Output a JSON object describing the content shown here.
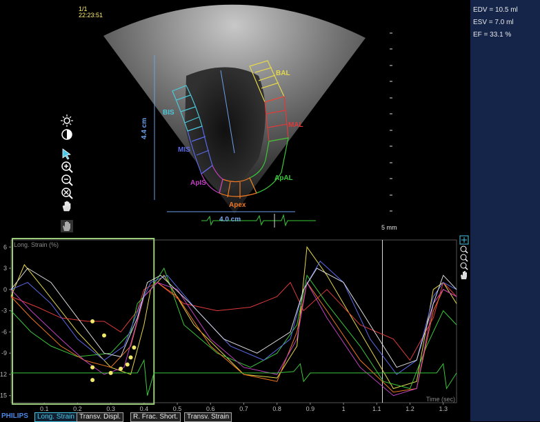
{
  "header": {
    "frame_counter": "1/1",
    "time": "22:23:51"
  },
  "measurements": {
    "edv": "EDV = 10.5 ml",
    "esv": "ESV = 7.0 ml",
    "ef": "EF = 33.1 %"
  },
  "segments": {
    "bal": "BAL",
    "mal": "MAL",
    "apal": "ApAL",
    "apex": "Apex",
    "apis": "ApIS",
    "mis": "MIS",
    "bis": "BIS"
  },
  "dimensions": {
    "vertical": "4.4 cm",
    "horizontal": "4.0 cm",
    "depth": "5 mm"
  },
  "colors": {
    "bal": "#e6d84a",
    "mal": "#e03a3a",
    "apal": "#3ac83a",
    "apex": "#f07820",
    "apis": "#c040c0",
    "mis": "#5a6ae8",
    "bis": "#4ac8d8"
  },
  "chart_data": {
    "type": "line",
    "ylabel": "Long. Strain (%)",
    "xlabel": "Time (sec)",
    "xlim": [
      0.0,
      1.34
    ],
    "ylim": [
      -16,
      7
    ],
    "x_ticks": [
      "0.1",
      "0.2",
      "0.3",
      "0.4",
      "0.5",
      "0.6",
      "0.7",
      "0.8",
      "0.9",
      "1",
      "1.1",
      "1.2",
      "1.3"
    ],
    "y_ticks": [
      "6",
      "3",
      "0",
      "-3",
      "-6",
      "-9",
      "-12",
      "-15"
    ],
    "series": [
      {
        "name": "BAL",
        "color": "#e6d84a",
        "points": [
          [
            0.0,
            -1
          ],
          [
            0.04,
            3.5
          ],
          [
            0.1,
            0
          ],
          [
            0.2,
            -6
          ],
          [
            0.3,
            -11
          ],
          [
            0.36,
            -12
          ],
          [
            0.4,
            -5
          ],
          [
            0.42,
            0
          ],
          [
            0.46,
            2
          ],
          [
            0.55,
            -5
          ],
          [
            0.7,
            -12
          ],
          [
            0.8,
            -12.5
          ],
          [
            0.86,
            -8
          ],
          [
            0.89,
            6
          ],
          [
            0.95,
            2
          ],
          [
            1.05,
            -6
          ],
          [
            1.15,
            -14
          ],
          [
            1.22,
            -13
          ],
          [
            1.27,
            0
          ],
          [
            1.3,
            1
          ],
          [
            1.34,
            -2
          ]
        ]
      },
      {
        "name": "MAL",
        "color": "#e03a3a",
        "points": [
          [
            0.0,
            -1
          ],
          [
            0.08,
            -2.5
          ],
          [
            0.15,
            -4
          ],
          [
            0.23,
            -4.5
          ],
          [
            0.28,
            -4.5
          ],
          [
            0.33,
            -6
          ],
          [
            0.38,
            -3
          ],
          [
            0.4,
            0
          ],
          [
            0.44,
            1
          ],
          [
            0.52,
            -2
          ],
          [
            0.62,
            -3
          ],
          [
            0.72,
            -2.5
          ],
          [
            0.8,
            -1
          ],
          [
            0.84,
            1
          ],
          [
            0.88,
            -3
          ],
          [
            0.95,
            0
          ],
          [
            1.05,
            -5
          ],
          [
            1.15,
            -7
          ],
          [
            1.2,
            -10
          ],
          [
            1.27,
            -4
          ],
          [
            1.3,
            1
          ],
          [
            1.34,
            -1
          ]
        ]
      },
      {
        "name": "ApAL",
        "color": "#3ac83a",
        "points": [
          [
            0.0,
            -3
          ],
          [
            0.06,
            -6
          ],
          [
            0.12,
            -8
          ],
          [
            0.2,
            -9.5
          ],
          [
            0.3,
            -9
          ],
          [
            0.36,
            -6
          ],
          [
            0.38,
            -2
          ],
          [
            0.42,
            0
          ],
          [
            0.46,
            3
          ],
          [
            0.52,
            -5
          ],
          [
            0.62,
            -9
          ],
          [
            0.72,
            -11
          ],
          [
            0.8,
            -9
          ],
          [
            0.86,
            -5
          ],
          [
            0.89,
            2
          ],
          [
            0.95,
            -2
          ],
          [
            1.05,
            -8
          ],
          [
            1.12,
            -13
          ],
          [
            1.2,
            -14
          ],
          [
            1.25,
            -8
          ],
          [
            1.3,
            -3
          ],
          [
            1.34,
            -5
          ]
        ]
      },
      {
        "name": "Apex",
        "color": "#f07820",
        "points": [
          [
            0.0,
            -1
          ],
          [
            0.06,
            -4
          ],
          [
            0.15,
            -8
          ],
          [
            0.22,
            -10
          ],
          [
            0.3,
            -11
          ],
          [
            0.36,
            -8
          ],
          [
            0.4,
            -1
          ],
          [
            0.44,
            1
          ],
          [
            0.5,
            -1
          ],
          [
            0.6,
            -8
          ],
          [
            0.7,
            -12
          ],
          [
            0.8,
            -13
          ],
          [
            0.86,
            -6
          ],
          [
            0.89,
            1
          ],
          [
            0.95,
            -3
          ],
          [
            1.05,
            -10
          ],
          [
            1.15,
            -14.5
          ],
          [
            1.22,
            -14
          ],
          [
            1.27,
            -3
          ],
          [
            1.3,
            0
          ],
          [
            1.34,
            -1
          ]
        ]
      },
      {
        "name": "ApIS",
        "color": "#c040c0",
        "points": [
          [
            0.0,
            0
          ],
          [
            0.06,
            -3
          ],
          [
            0.15,
            -7
          ],
          [
            0.22,
            -10
          ],
          [
            0.28,
            -12
          ],
          [
            0.34,
            -11
          ],
          [
            0.4,
            -1
          ],
          [
            0.44,
            1
          ],
          [
            0.5,
            0
          ],
          [
            0.6,
            -7
          ],
          [
            0.7,
            -11
          ],
          [
            0.8,
            -12
          ],
          [
            0.86,
            -7
          ],
          [
            0.89,
            1
          ],
          [
            0.95,
            -4
          ],
          [
            1.05,
            -11
          ],
          [
            1.15,
            -15
          ],
          [
            1.22,
            -14
          ],
          [
            1.27,
            -2
          ],
          [
            1.3,
            0
          ],
          [
            1.34,
            -1
          ]
        ]
      },
      {
        "name": "MIS",
        "color": "#5a6ae8",
        "points": [
          [
            0.0,
            0
          ],
          [
            0.05,
            1
          ],
          [
            0.12,
            -2
          ],
          [
            0.2,
            -7
          ],
          [
            0.28,
            -10
          ],
          [
            0.34,
            -8
          ],
          [
            0.39,
            -2
          ],
          [
            0.42,
            1
          ],
          [
            0.47,
            2
          ],
          [
            0.56,
            -3
          ],
          [
            0.66,
            -8
          ],
          [
            0.76,
            -10
          ],
          [
            0.84,
            -7
          ],
          [
            0.88,
            0
          ],
          [
            0.93,
            4
          ],
          [
            1.0,
            1
          ],
          [
            1.08,
            -7
          ],
          [
            1.16,
            -12
          ],
          [
            1.22,
            -10
          ],
          [
            1.27,
            -1
          ],
          [
            1.3,
            1
          ],
          [
            1.34,
            0
          ]
        ]
      },
      {
        "name": "BIS",
        "color": "#dcdcdc",
        "points": [
          [
            0.0,
            0
          ],
          [
            0.05,
            3
          ],
          [
            0.12,
            1
          ],
          [
            0.2,
            -4
          ],
          [
            0.28,
            -9
          ],
          [
            0.33,
            -9.5
          ],
          [
            0.38,
            -4
          ],
          [
            0.41,
            1
          ],
          [
            0.45,
            2
          ],
          [
            0.54,
            -2
          ],
          [
            0.64,
            -7
          ],
          [
            0.74,
            -9
          ],
          [
            0.84,
            -6
          ],
          [
            0.88,
            0
          ],
          [
            0.92,
            3
          ],
          [
            1.0,
            1
          ],
          [
            1.08,
            -5
          ],
          [
            1.16,
            -11
          ],
          [
            1.22,
            -10
          ],
          [
            1.27,
            -2
          ],
          [
            1.3,
            2
          ],
          [
            1.34,
            0
          ]
        ]
      },
      {
        "name": "ECG",
        "color": "#3ac83a",
        "points": [
          [
            0.0,
            -11.8
          ],
          [
            0.2,
            -11.8
          ],
          [
            0.38,
            -11.8
          ],
          [
            0.4,
            -10
          ],
          [
            0.41,
            -15
          ],
          [
            0.43,
            -11.8
          ],
          [
            0.8,
            -11.8
          ],
          [
            0.85,
            -11.6
          ],
          [
            0.87,
            -10.5
          ],
          [
            0.88,
            -13
          ],
          [
            0.9,
            -11.8
          ],
          [
            1.28,
            -11.8
          ],
          [
            1.3,
            -10.5
          ],
          [
            1.31,
            -14
          ],
          [
            1.34,
            -11.8
          ]
        ]
      }
    ],
    "markers": [
      [
        0.245,
        -4.5
      ],
      [
        0.28,
        -6.5
      ],
      [
        0.37,
        -8.2
      ],
      [
        0.36,
        -9.6
      ],
      [
        0.35,
        -10.6
      ],
      [
        0.3,
        -11.8
      ],
      [
        0.33,
        -11.2
      ],
      [
        0.245,
        -11
      ],
      [
        0.245,
        -12.8
      ]
    ],
    "selection_range": [
      0.0,
      0.43
    ],
    "cursor_x": 1.117,
    "grid": false
  },
  "tabs": {
    "logo": "PHILIPS",
    "long_strain": "Long. Strain",
    "transv_displ": "Transv. Displ.",
    "r_frac_short": "R. Frac. Short.",
    "transv_strain": "Transv. Strain"
  }
}
